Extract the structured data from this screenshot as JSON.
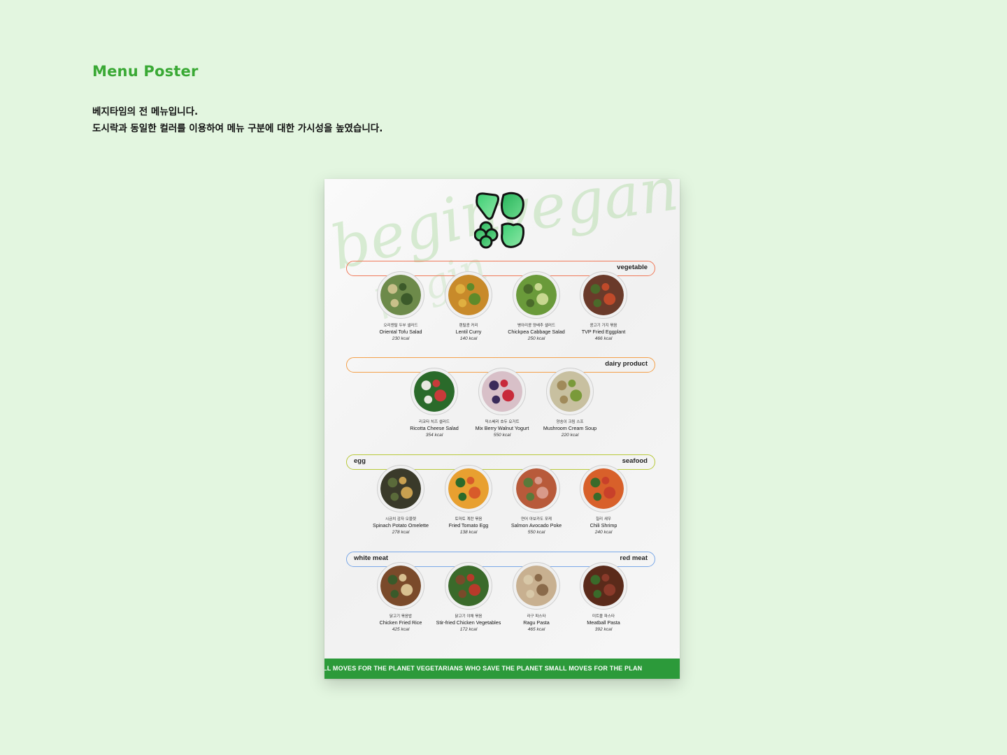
{
  "page_title": "Menu Poster",
  "description": {
    "line1": "베지타임의 전 메뉴입니다.",
    "line2": "도시락과 동일한 컬러를 이용하여 메뉴 구분에 대한 가시성을 높였습니다."
  },
  "poster": {
    "background_script": [
      "begin",
      "vegan",
      "begin"
    ],
    "sections": [
      {
        "label_right": "vegetable",
        "color": "#f07a5a",
        "items": [
          {
            "kr": "오리엔탈 두부 샐러드",
            "en": "Oriental Tofu Salad",
            "kcal": "230 kcal"
          },
          {
            "kr": "렌틸콩 커리",
            "en": "Lentil Curry",
            "kcal": "140 kcal"
          },
          {
            "kr": "병아리콩 양배추 샐러드",
            "en": "Chickpea Cabbage Salad",
            "kcal": "250 kcal"
          },
          {
            "kr": "콩고기 가지 볶음",
            "en": "TVP Fried Eggplant",
            "kcal": "466 kcal"
          }
        ]
      },
      {
        "label_right": "dairy product",
        "color": "#f4a04a",
        "items": [
          {
            "kr": "리코타 치즈 샐러드",
            "en": "Ricotta Cheese Salad",
            "kcal": "354 kcal"
          },
          {
            "kr": "믹스베리 호두 요거트",
            "en": "Mix Berry Walnut Yogurt",
            "kcal": "550 kcal"
          },
          {
            "kr": "양송이 크림 스프",
            "en": "Mushroom Cream Soup",
            "kcal": "220 kcal"
          }
        ]
      },
      {
        "label_left": "egg",
        "label_right": "seafood",
        "color": "#b8c93a",
        "items": [
          {
            "kr": "시금치 감자 오믈렛",
            "en": "Spinach Potato Omelette",
            "kcal": "278 kcal"
          },
          {
            "kr": "토마토 계란 볶음",
            "en": "Fried Tomato Egg",
            "kcal": "138 kcal"
          },
          {
            "kr": "연어 아보카도 포케",
            "en": "Salmon Avocado Poke",
            "kcal": "550 kcal"
          },
          {
            "kr": "칠리 새우",
            "en": "Chili Shrimp",
            "kcal": "240 kcal"
          }
        ]
      },
      {
        "label_left": "white meat",
        "label_right": "red meat",
        "color": "#7aa8e8",
        "items": [
          {
            "kr": "닭고기 볶음밥",
            "en": "Chicken Fried Rice",
            "kcal": "425 kcal"
          },
          {
            "kr": "닭고기 야채 볶음",
            "en": "Stir-fried Chicken Vegetables",
            "kcal": "172 kcal"
          },
          {
            "kr": "라구 파스타",
            "en": "Ragu Pasta",
            "kcal": "465 kcal"
          },
          {
            "kr": "미트볼 파스타",
            "en": "Meatball Pasta",
            "kcal": "392 kcal"
          }
        ]
      }
    ],
    "footer_text": "LL MOVES FOR THE PLANET VEGETARIANS WHO SAVE THE PLANET SMALL MOVES FOR THE PLAN",
    "colors": {
      "brand_green": "#2c9a3a",
      "title_green": "#3aa935"
    }
  }
}
